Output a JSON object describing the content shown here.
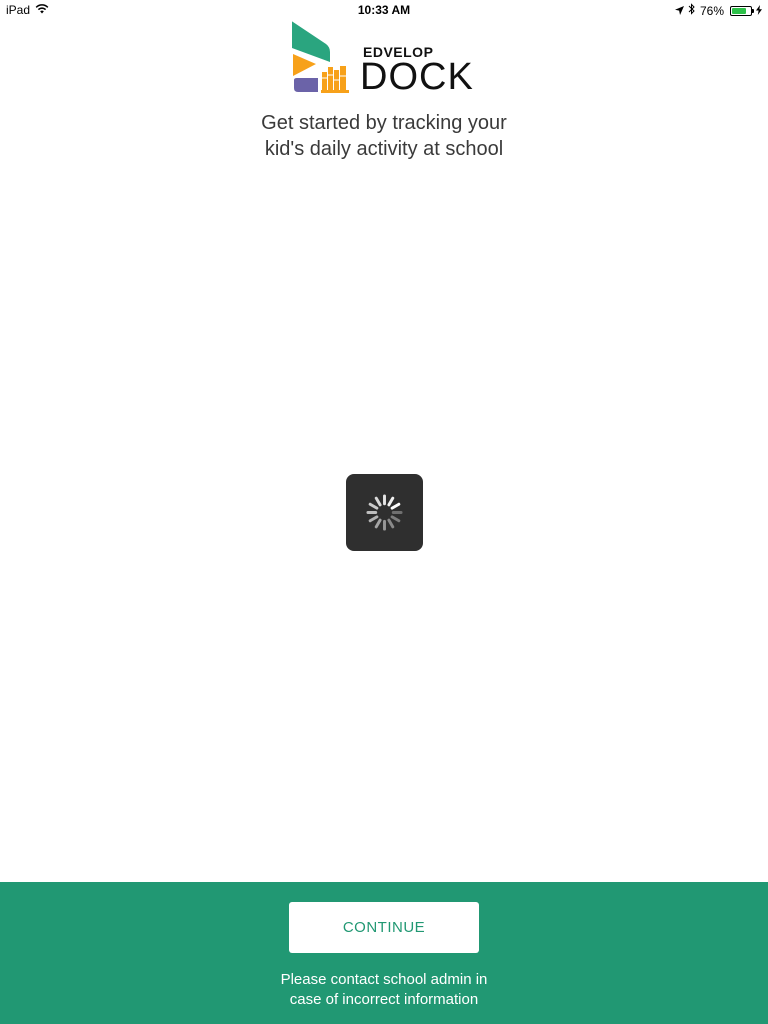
{
  "status_bar": {
    "device": "iPad",
    "time": "10:33 AM",
    "battery_percent_label": "76%",
    "battery_level": 0.76,
    "icons": [
      "wifi-icon",
      "location-arrow-icon",
      "bluetooth-icon",
      "battery-icon",
      "charging-bolt-icon"
    ]
  },
  "logo": {
    "small_text": "EDVELOP",
    "big_text": "DOCK",
    "colors": {
      "green": "#2aa57f",
      "orange": "#f7a11a",
      "purple": "#6b63a8"
    }
  },
  "tagline": {
    "line1": "Get started by tracking your",
    "line2": "kid's daily activity at school"
  },
  "loader": {
    "icon": "spinner-icon"
  },
  "footer": {
    "background": "#219873",
    "continue_label": "CONTINUE",
    "note_line1": "Please contact school admin in",
    "note_line2": "case of incorrect information"
  }
}
